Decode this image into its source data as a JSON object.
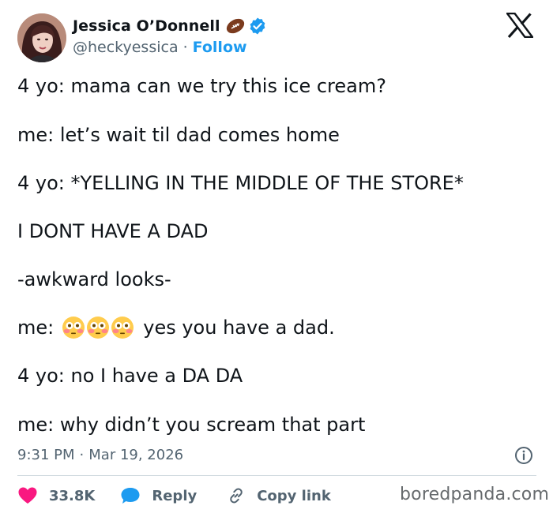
{
  "author": {
    "display_name": "Jessica O’Donnell",
    "handle": "@heckyessica",
    "separator": "·",
    "follow_label": "Follow"
  },
  "tweet": {
    "lines": [
      "4 yo: mama can we try this ice cream?",
      "me: let’s wait til dad comes home",
      "4 yo: *YELLING IN THE MIDDLE OF THE STORE*",
      "I DONT HAVE A DAD",
      "-awkward looks-",
      "me:",
      "4 yo: no I have a DA DA",
      "me: why didn’t you scream that part"
    ],
    "line6_suffix": "yes you have a dad.",
    "emojis": [
      "flushed-face-emoji",
      "flushed-face-emoji",
      "flushed-face-emoji"
    ]
  },
  "meta": {
    "time": "9:31 PM",
    "separator": "·",
    "date": "Mar 19, 2026"
  },
  "actions": {
    "likes": "33.8K",
    "reply_label": "Reply",
    "copy_link_label": "Copy link"
  },
  "watermark": "boredpanda.com",
  "colors": {
    "text": "#0f1419",
    "secondary": "#536471",
    "link": "#1d9bf0",
    "like": "#f91880",
    "divider": "#cfd9de"
  },
  "icons": {
    "brand": "x-logo-icon",
    "badge": "verified-badge-icon",
    "football": "american-football-emoji",
    "info": "info-icon",
    "like": "heart-icon",
    "reply": "speech-bubble-icon",
    "copy": "link-icon"
  }
}
